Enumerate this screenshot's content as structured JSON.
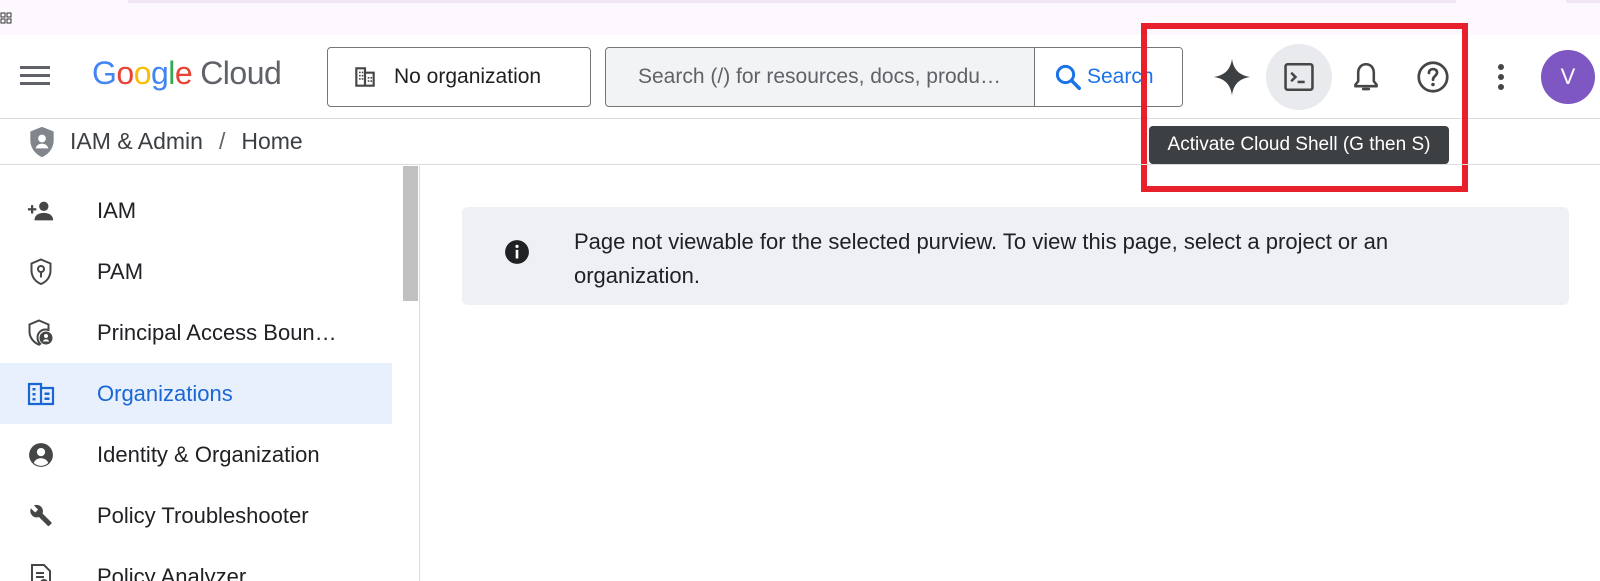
{
  "header": {
    "logo_parts": [
      "G",
      "o",
      "o",
      "g",
      "l",
      "e"
    ],
    "logo_suffix": "Cloud",
    "org_selector": "No organization",
    "search_placeholder": "Search (/) for resources, docs, produ…",
    "search_button": "Search",
    "avatar_initial": "V",
    "tooltip": "Activate Cloud Shell (G then S)"
  },
  "breadcrumb": {
    "section": "IAM & Admin",
    "separator": "/",
    "page": "Home"
  },
  "sidebar": {
    "items": [
      {
        "label": "IAM",
        "icon": "person-add-icon"
      },
      {
        "label": "PAM",
        "icon": "shield-key-icon"
      },
      {
        "label": "Principal Access Boun…",
        "icon": "shield-person-icon"
      },
      {
        "label": "Organizations",
        "icon": "organization-icon",
        "selected": true
      },
      {
        "label": "Identity & Organization",
        "icon": "account-circle-icon"
      },
      {
        "label": "Policy Troubleshooter",
        "icon": "wrench-icon"
      },
      {
        "label": "Policy Analyzer",
        "icon": "document-search-icon"
      }
    ]
  },
  "main": {
    "notice": "Page not viewable for the selected purview. To view this page, select a project or an organization."
  },
  "colors": {
    "accent": "#1a73e8",
    "selected_bg": "#e8f0fe",
    "highlight": "#e8202c",
    "avatar": "#7e57c2"
  }
}
